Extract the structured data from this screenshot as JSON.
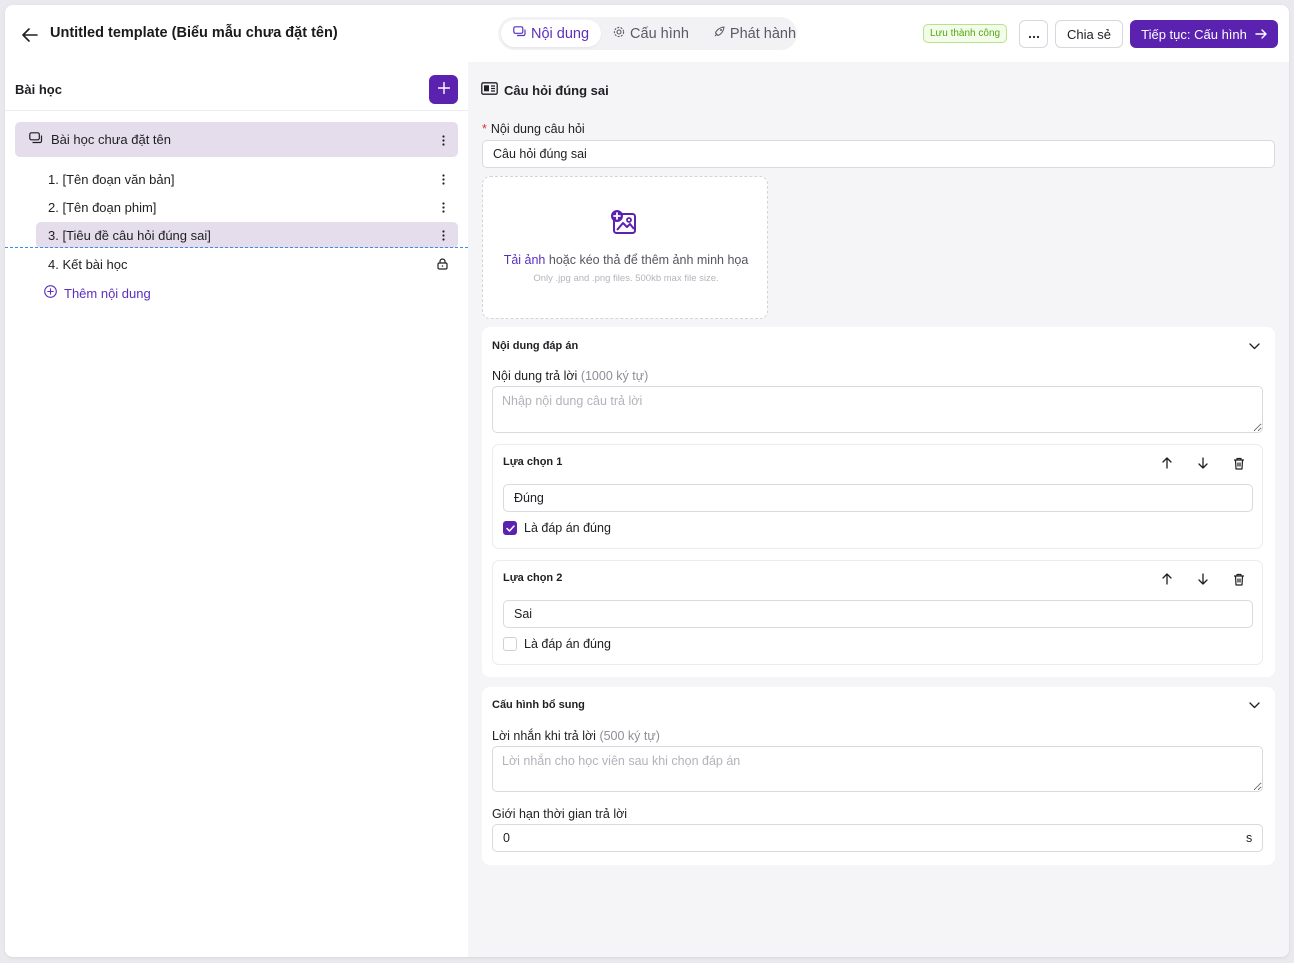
{
  "header": {
    "title": "Untitled template (Biểu mẫu chưa đặt tên)",
    "tabs": [
      {
        "label": "Nội dung",
        "icon": "message-icon",
        "active": true
      },
      {
        "label": "Cấu hình",
        "icon": "gear-icon",
        "active": false
      },
      {
        "label": "Phát hành",
        "icon": "rocket-icon",
        "active": false
      }
    ],
    "saved_badge": "Lưu thành công",
    "more_label": "···",
    "share_label": "Chia sẻ",
    "continue_label": "Tiếp tục: Cấu hình",
    "accent": "#5b22b0"
  },
  "sidebar": {
    "title": "Bài học",
    "lesson": {
      "label": "Bài học chưa đặt tên"
    },
    "items": [
      {
        "label": "1. [Tên đoạn văn bản]",
        "icon": "kebab-icon"
      },
      {
        "label": "2. [Tên đoạn phim]",
        "icon": "kebab-icon"
      },
      {
        "label": "3. [Tiêu đề câu hỏi đúng sai]",
        "icon": "kebab-icon",
        "selected": true
      },
      {
        "label": "4. Kết bài học",
        "icon": "lock-icon"
      }
    ],
    "add_content": "Thêm nội dung"
  },
  "main": {
    "heading": "Câu hỏi đúng sai",
    "question_label": "Nội dung câu hỏi",
    "question_value": "Câu hỏi đúng sai",
    "upload": {
      "link": "Tải ảnh",
      "text": " hoặc kéo thả để thêm ảnh minh họa",
      "hint": "Only .jpg and .png files. 500kb max file size."
    },
    "answers_panel": {
      "title": "Nội dung đáp án",
      "answer_label": "Nội dung trả lời",
      "answer_limit": "(1000 ký tự)",
      "answer_placeholder": "Nhập nội dung câu trả lời",
      "choices": [
        {
          "title": "Lựa chọn 1",
          "value": "Đúng",
          "correct_label": "Là đáp án đúng",
          "checked": true
        },
        {
          "title": "Lựa chọn 2",
          "value": "Sai",
          "correct_label": "Là đáp án đúng",
          "checked": false
        }
      ]
    },
    "extra_panel": {
      "title": "Cấu hình bổ sung",
      "message_label": "Lời nhắn khi trả lời",
      "message_limit": "(500 ký tự)",
      "message_placeholder": "Lời nhắn cho học viên sau khi chọn đáp án",
      "time_label": "Giới hạn thời gian trả lời",
      "time_value": "0",
      "time_unit": "s"
    }
  }
}
